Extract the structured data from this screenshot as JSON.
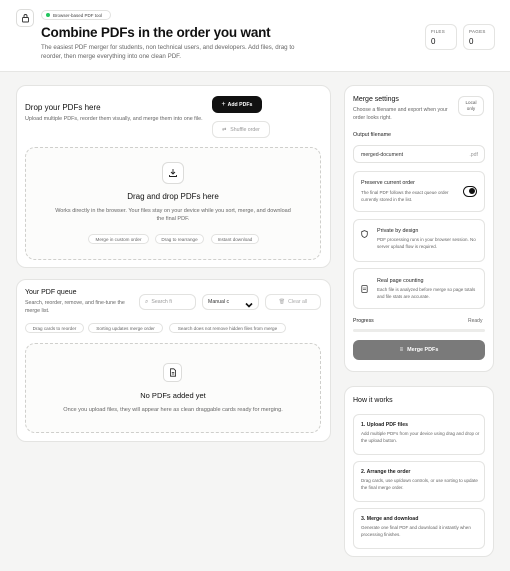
{
  "header": {
    "badge": "Browser-based PDF tool",
    "title": "Combine PDFs in the order you want",
    "subtitle": "The easiest PDF merger for students, non technical users, and developers. Add files, drag to reorder, then merge everything into one clean PDF.",
    "stats": [
      {
        "label": "FILES",
        "value": "0"
      },
      {
        "label": "PAGES",
        "value": "0"
      }
    ]
  },
  "drop": {
    "title": "Drop your PDFs here",
    "desc": "Upload multiple PDFs, reorder them visually, and merge them into one file.",
    "add_label": "Add PDFs",
    "shuffle_label": "Shuffle order",
    "zone_title": "Drag and drop PDFs here",
    "zone_desc": "Works directly in the browser. Your files stay on your device while you sort, merge, and download the final PDF.",
    "chips": [
      "Merge in custom order",
      "Drag to rearrange",
      "Instant download"
    ]
  },
  "queue": {
    "title": "Your PDF queue",
    "desc": "Search, reorder, remove, and fine-tune the merge list.",
    "search_placeholder": "Search fi",
    "sort_value": "Manual c",
    "clear_label": "Clear all",
    "hints": [
      "Drag cards to reorder",
      "Sorting updates merge order",
      "Search does not remove hidden files from merge"
    ],
    "empty_title": "No PDFs added yet",
    "empty_desc": "Once you upload files, they will appear here as clean draggable cards ready for merging."
  },
  "settings": {
    "title": "Merge settings",
    "desc": "Choose a filename and export when your order looks right.",
    "local_label": "Local only",
    "filename_label": "Output filename",
    "filename_value": "merged-document",
    "filename_ext": ".pdf",
    "preserve_title": "Preserve current order",
    "preserve_desc": "The final PDF follows the exact queue order currently stored in the list.",
    "preserve_on": true,
    "privacy_title": "Private by design",
    "privacy_desc": "PDF processing runs in your browser session. No server upload flow is required.",
    "counting_title": "Real page counting",
    "counting_desc": "Each file is analyzed before merge so page totals and file stats are accurate.",
    "progress_label": "Progress",
    "progress_status": "Ready",
    "progress_value": 0,
    "merge_label": "Merge PDFs"
  },
  "how": {
    "title": "How it works",
    "steps": [
      {
        "title": "1. Upload PDF files",
        "desc": "Add multiple PDFs from your device using drag and drop or the upload button."
      },
      {
        "title": "2. Arrange the order",
        "desc": "Drag cards, use up/down controls, or use sorting to update the final merge order."
      },
      {
        "title": "3. Merge and download",
        "desc": "Generate one final PDF and download it instantly when processing finishes."
      }
    ]
  },
  "colors": {
    "accent": "#111111",
    "badge_dot": "#22c55e",
    "merge_btn": "#7a7a7a"
  }
}
